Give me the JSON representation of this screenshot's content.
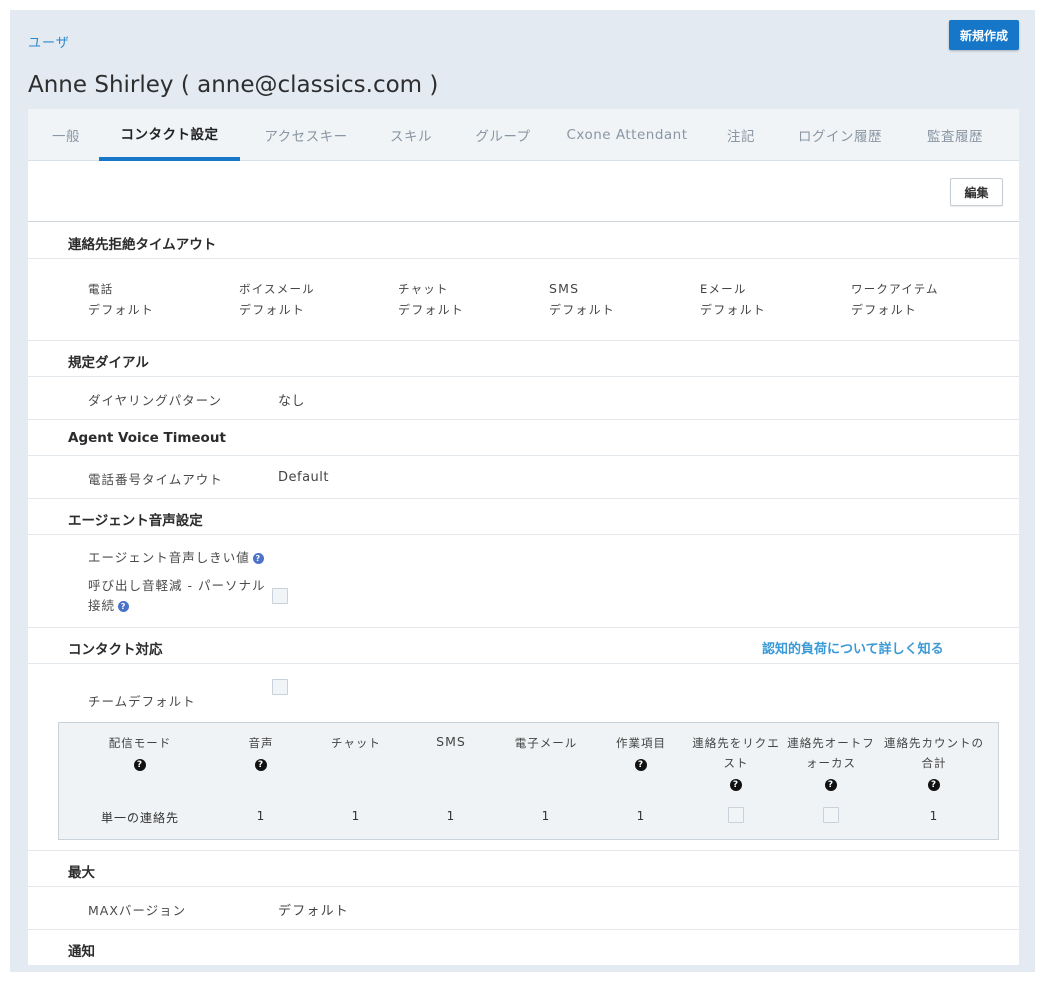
{
  "breadcrumb": "ユーザ",
  "new_button": "新規作成",
  "page_title": "Anne Shirley ( anne@classics.com )",
  "tabs": [
    "一般",
    "コンタクト設定",
    "アクセスキー",
    "スキル",
    "グループ",
    "Cxone Attendant",
    "注記",
    "ログイン履歴",
    "監査履歴"
  ],
  "active_tab": "コンタクト設定",
  "edit_button": "編集",
  "sections": {
    "rejection_timeout": {
      "title": "連絡先拒絶タイムアウト",
      "channels": [
        {
          "label": "電話",
          "value": "デフォルト"
        },
        {
          "label": "ボイスメール",
          "value": "デフォルト"
        },
        {
          "label": "チャット",
          "value": "デフォルト"
        },
        {
          "label": "SMS",
          "value": "デフォルト"
        },
        {
          "label": "Eメール",
          "value": "デフォルト"
        },
        {
          "label": "ワークアイテム",
          "value": "デフォルト"
        }
      ]
    },
    "default_dial": {
      "title": "規定ダイアル",
      "label": "ダイヤリングパターン",
      "value": "なし"
    },
    "voice_timeout": {
      "title": "Agent Voice Timeout",
      "label": "電話番号タイムアウト",
      "value": "Default"
    },
    "agent_voice": {
      "title": "エージェント音声設定",
      "threshold_label": "エージェント音声しきい値",
      "ring_label_line1": "呼び出し音軽減 - パーソナル",
      "ring_label_line2": "接続",
      "ring_checked": false
    },
    "contact_handling": {
      "title": "コンタクト対応",
      "link": "認知的負荷について詳しく知る",
      "team_default_label": "チームデフォルト",
      "team_default_checked": false,
      "table": {
        "headers": [
          {
            "text": "配信モード",
            "help": true
          },
          {
            "text": "音声",
            "help": true
          },
          {
            "text": "チャット",
            "help": false
          },
          {
            "text": "SMS",
            "help": false
          },
          {
            "text": "電子メール",
            "help": false
          },
          {
            "text": "作業項目",
            "help": true
          },
          {
            "text": "連絡先をリクエスト",
            "help": true
          },
          {
            "text": "連絡先オートフォーカス",
            "help": true
          },
          {
            "text": "連絡先カウントの合計",
            "help": true
          }
        ],
        "row": {
          "mode": "単一の連絡先",
          "voice": "1",
          "chat": "1",
          "sms": "1",
          "email": "1",
          "work_item": "1",
          "request_contact": false,
          "auto_focus": false,
          "total": "1"
        }
      }
    },
    "max": {
      "title": "最大",
      "label": "MAXバージョン",
      "value": "デフォルト"
    },
    "notification": {
      "title": "通知"
    }
  },
  "colors": {
    "accent": "#1677c9",
    "link": "#3b9ad6",
    "background": "#e3eaf2"
  }
}
